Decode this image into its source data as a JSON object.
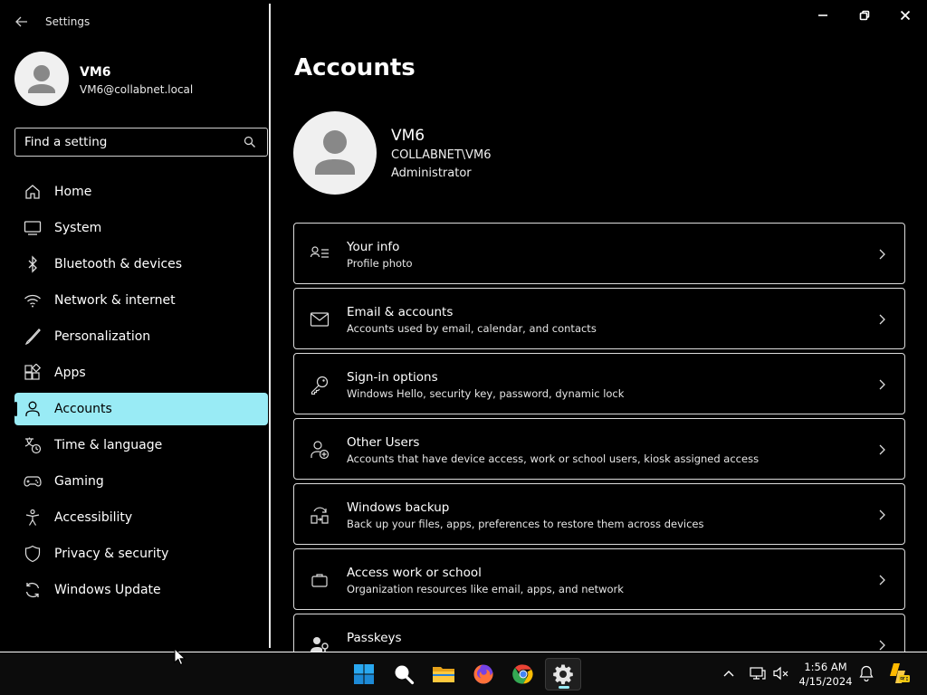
{
  "window": {
    "title": "Settings"
  },
  "user": {
    "name": "VM6",
    "email": "VM6@collabnet.local"
  },
  "search": {
    "placeholder": "Find a setting"
  },
  "sidebar": {
    "items": [
      {
        "label": "Home",
        "icon": "home-icon"
      },
      {
        "label": "System",
        "icon": "monitor-icon"
      },
      {
        "label": "Bluetooth & devices",
        "icon": "bluetooth-icon"
      },
      {
        "label": "Network & internet",
        "icon": "wifi-icon"
      },
      {
        "label": "Personalization",
        "icon": "brush-icon"
      },
      {
        "label": "Apps",
        "icon": "apps-icon"
      },
      {
        "label": "Accounts",
        "icon": "person-icon",
        "selected": true
      },
      {
        "label": "Time & language",
        "icon": "globe-clock-icon"
      },
      {
        "label": "Gaming",
        "icon": "gamepad-icon"
      },
      {
        "label": "Accessibility",
        "icon": "accessibility-icon"
      },
      {
        "label": "Privacy & security",
        "icon": "shield-icon"
      },
      {
        "label": "Windows Update",
        "icon": "sync-icon"
      }
    ]
  },
  "main": {
    "title": "Accounts",
    "profile": {
      "name": "VM6",
      "domain": "COLLABNET\\VM6",
      "role": "Administrator"
    },
    "cards": [
      {
        "title": "Your info",
        "subtitle": "Profile photo",
        "icon": "person-list-icon"
      },
      {
        "title": "Email & accounts",
        "subtitle": "Accounts used by email, calendar, and contacts",
        "icon": "mail-icon"
      },
      {
        "title": "Sign-in options",
        "subtitle": "Windows Hello, security key, password, dynamic lock",
        "icon": "key-icon"
      },
      {
        "title": "Other Users",
        "subtitle": "Accounts that have device access, work or school users, kiosk assigned access",
        "icon": "person-add-icon"
      },
      {
        "title": "Windows backup",
        "subtitle": "Back up your files, apps, preferences to restore them across devices",
        "icon": "backup-icon"
      },
      {
        "title": "Access work or school",
        "subtitle": "Organization resources like email, apps, and network",
        "icon": "briefcase-icon"
      },
      {
        "title": "Passkeys",
        "subtitle": "",
        "icon": "passkey-icon"
      }
    ]
  },
  "taskbar": {
    "apps": [
      "start-icon",
      "search-icon",
      "file-explorer-icon",
      "firefox-icon",
      "chrome-icon",
      "settings-icon"
    ],
    "active_app": "settings-icon",
    "time": "1:56 AM",
    "date": "4/15/2024"
  },
  "colors": {
    "accent": "#99ebf5",
    "background": "#000000",
    "border": "#dcdcdc"
  }
}
